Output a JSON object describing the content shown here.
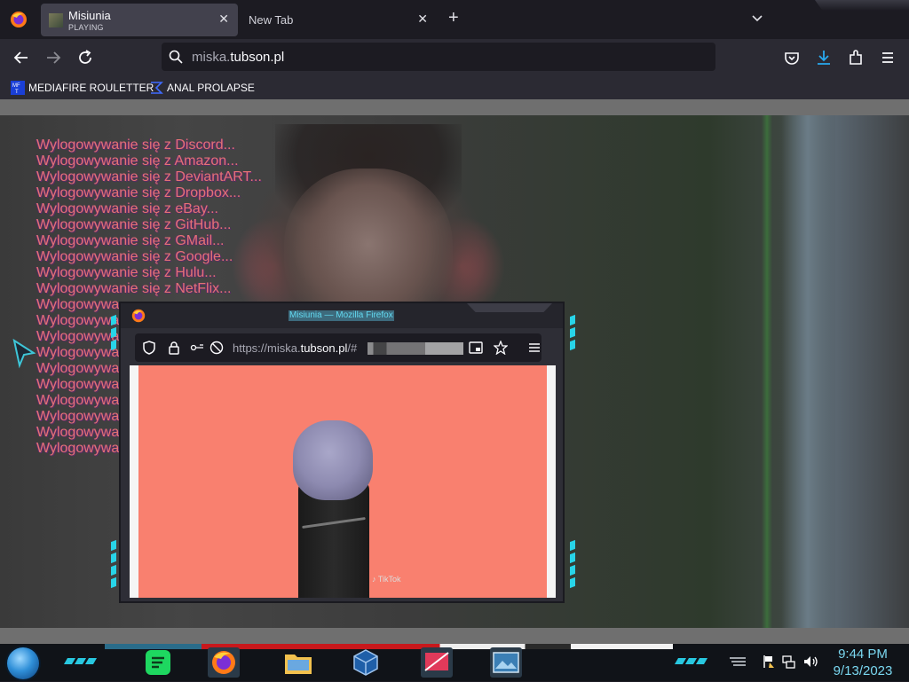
{
  "browser": {
    "tabs": [
      {
        "title": "Misiunia",
        "subtitle": "PLAYING",
        "active": true
      },
      {
        "title": "New Tab",
        "active": false
      }
    ],
    "address": {
      "dim_part": "miska.",
      "host_part": "tubson.pl"
    },
    "bookmarks": [
      {
        "label": "MEDIAFIRE ROULETTER",
        "icon": "mediafire-icon"
      },
      {
        "label": "ANAL PROLAPSE",
        "icon": "sigma-icon"
      }
    ]
  },
  "page": {
    "logout_lines": [
      "Wylogowywanie się z Discord...",
      "Wylogowywanie się z Amazon...",
      "Wylogowywanie się z DeviantART...",
      "Wylogowywanie się z Dropbox...",
      "Wylogowywanie się z eBay...",
      "Wylogowywanie się z GitHub...",
      "Wylogowywanie się z GMail...",
      "Wylogowywanie się z Google...",
      "Wylogowywanie się z Hulu...",
      "Wylogowywanie się z NetFlix...",
      "Wylogowywa",
      "Wylogowywa",
      "Wylogowywa",
      "Wylogowywa",
      "Wylogowywa",
      "Wylogowywa",
      "Wylogowywa",
      "Wylogowywa",
      "Wylogowywa",
      "Wylogowywa"
    ],
    "text_color": "#e37373"
  },
  "popup": {
    "title": "Misiunia — Mozilla Firefox",
    "url_prefix": "https://miska.",
    "url_host": "tubson.pl",
    "url_suffix": "/#",
    "video_bg": "#f9806f",
    "watermark": "♪ TikTok"
  },
  "taskbar": {
    "apps": [
      "spotify-icon",
      "firefox-icon",
      "file-explorer-icon",
      "virtualbox-icon",
      "screen-capture-icon",
      "photo-viewer-icon"
    ],
    "clock_time": "9:44 PM",
    "clock_date": "9/13/2023"
  },
  "colors": {
    "accent": "#28d4e8",
    "browser_bg": "#1c1b22",
    "toolbar_bg": "#2b2a33"
  }
}
